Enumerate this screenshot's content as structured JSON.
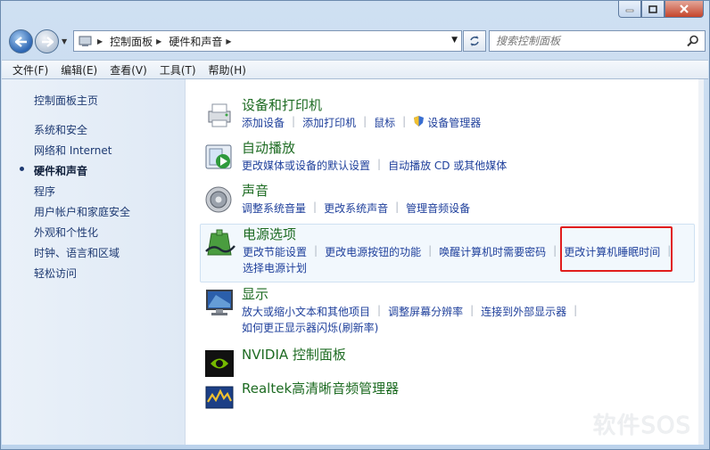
{
  "window": {
    "caption": {
      "minimize_glyph": "minimize-icon",
      "maximize_glyph": "maximize-icon",
      "close_glyph": "close-icon"
    }
  },
  "nav": {
    "breadcrumb": [
      "控制面板",
      "硬件和声音"
    ],
    "search_placeholder": "搜索控制面板"
  },
  "menu": [
    "文件(F)",
    "编辑(E)",
    "查看(V)",
    "工具(T)",
    "帮助(H)"
  ],
  "sidebar": {
    "items": [
      "控制面板主页",
      "系统和安全",
      "网络和 Internet",
      "硬件和声音",
      "程序",
      "用户帐户和家庭安全",
      "外观和个性化",
      "时钟、语言和区域",
      "轻松访问"
    ],
    "active_index": 3
  },
  "categories": [
    {
      "title": "设备和打印机",
      "icon": "printer-icon",
      "links": [
        [
          "添加设备",
          "添加打印机",
          "鼠标",
          "设备管理器"
        ]
      ]
    },
    {
      "title": "自动播放",
      "icon": "autoplay-icon",
      "links": [
        [
          "更改媒体或设备的默认设置",
          "自动播放 CD 或其他媒体"
        ]
      ]
    },
    {
      "title": "声音",
      "icon": "speaker-icon",
      "links": [
        [
          "调整系统音量",
          "更改系统声音",
          "管理音频设备"
        ]
      ]
    },
    {
      "title": "电源选项",
      "icon": "power-icon",
      "links": [
        [
          "更改节能设置",
          "更改电源按钮的功能",
          "唤醒计算机时需要密码",
          "更改计算机睡眠时间"
        ],
        [
          "选择电源计划"
        ]
      ]
    },
    {
      "title": "显示",
      "icon": "monitor-icon",
      "links": [
        [
          "放大或缩小文本和其他项目",
          "调整屏幕分辨率",
          "连接到外部显示器"
        ],
        [
          "如何更正显示器闪烁(刷新率)"
        ]
      ]
    },
    {
      "title": "NVIDIA 控制面板",
      "icon": "nvidia-icon",
      "links": []
    },
    {
      "title": "Realtek高清晰音频管理器",
      "icon": "realtek-icon",
      "links": []
    }
  ],
  "watermark": "软件SOS",
  "colors": {
    "link": "#1e3f9b",
    "category_title": "#1d6b22",
    "highlight_box": "#e11d1d"
  }
}
